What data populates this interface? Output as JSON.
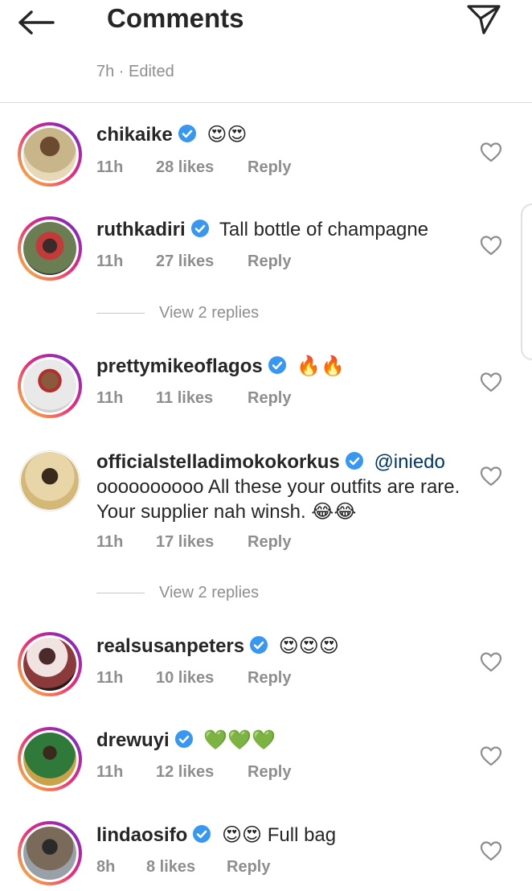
{
  "header": {
    "title": "Comments",
    "back_icon": "arrow-left-icon",
    "send_icon": "paper-plane-icon"
  },
  "caption": {
    "meta": "7h · Edited"
  },
  "reply_label": "Reply",
  "comments": [
    {
      "username": "chikaike",
      "verified": true,
      "mention": "",
      "text": "😍😍",
      "time": "11h",
      "likes": "28 likes",
      "avatar_colors": [
        "#c8b58a",
        "#5d4a2f"
      ]
    },
    {
      "username": "ruthkadiri",
      "verified": true,
      "mention": "",
      "text": "Tall bottle of champagne",
      "time": "11h",
      "likes": "27 likes",
      "avatar_colors": [
        "#6b7d52",
        "#c23a3a"
      ]
    },
    {
      "username": "prettymikeoflagos",
      "verified": true,
      "mention": "",
      "text": "🔥🔥",
      "time": "11h",
      "likes": "11 likes",
      "avatar_colors": [
        "#d9d9d9",
        "#8a5a3c"
      ]
    },
    {
      "username": "officialstelladimokokorkus",
      "verified": true,
      "mention": "@iniedo",
      "text": "oooooooooo All these your outfits are rare. Your supplier nah winsh. 😂😂",
      "time": "11h",
      "likes": "17 likes",
      "avatar_colors": [
        "#e8d5a8",
        "#3a2a1e"
      ]
    },
    {
      "username": "realsusanpeters",
      "verified": true,
      "mention": "",
      "text": "😍😍😍",
      "time": "11h",
      "likes": "10 likes",
      "avatar_colors": [
        "#f2e3e3",
        "#4a2a2a"
      ]
    },
    {
      "username": "drewuyi",
      "verified": true,
      "mention": "",
      "text": "💚💚💚",
      "time": "11h",
      "likes": "12 likes",
      "avatar_colors": [
        "#2f7a3a",
        "#c9a24a"
      ]
    },
    {
      "username": "lindaosifo",
      "verified": true,
      "mention": "",
      "text": "😍😍 Full bag",
      "time": "8h",
      "likes": "8 likes",
      "avatar_colors": [
        "#7a6a5a",
        "#2a2a2a"
      ]
    }
  ],
  "view_replies": [
    {
      "label": "View 2 replies"
    },
    {
      "label": "View 2 replies"
    }
  ],
  "colors": {
    "verified": "#3897f0",
    "meta_gray": "#8e8e8e",
    "ring_start": "#f9ce34",
    "ring_mid": "#ee2a7b",
    "ring_end": "#6228d7"
  }
}
